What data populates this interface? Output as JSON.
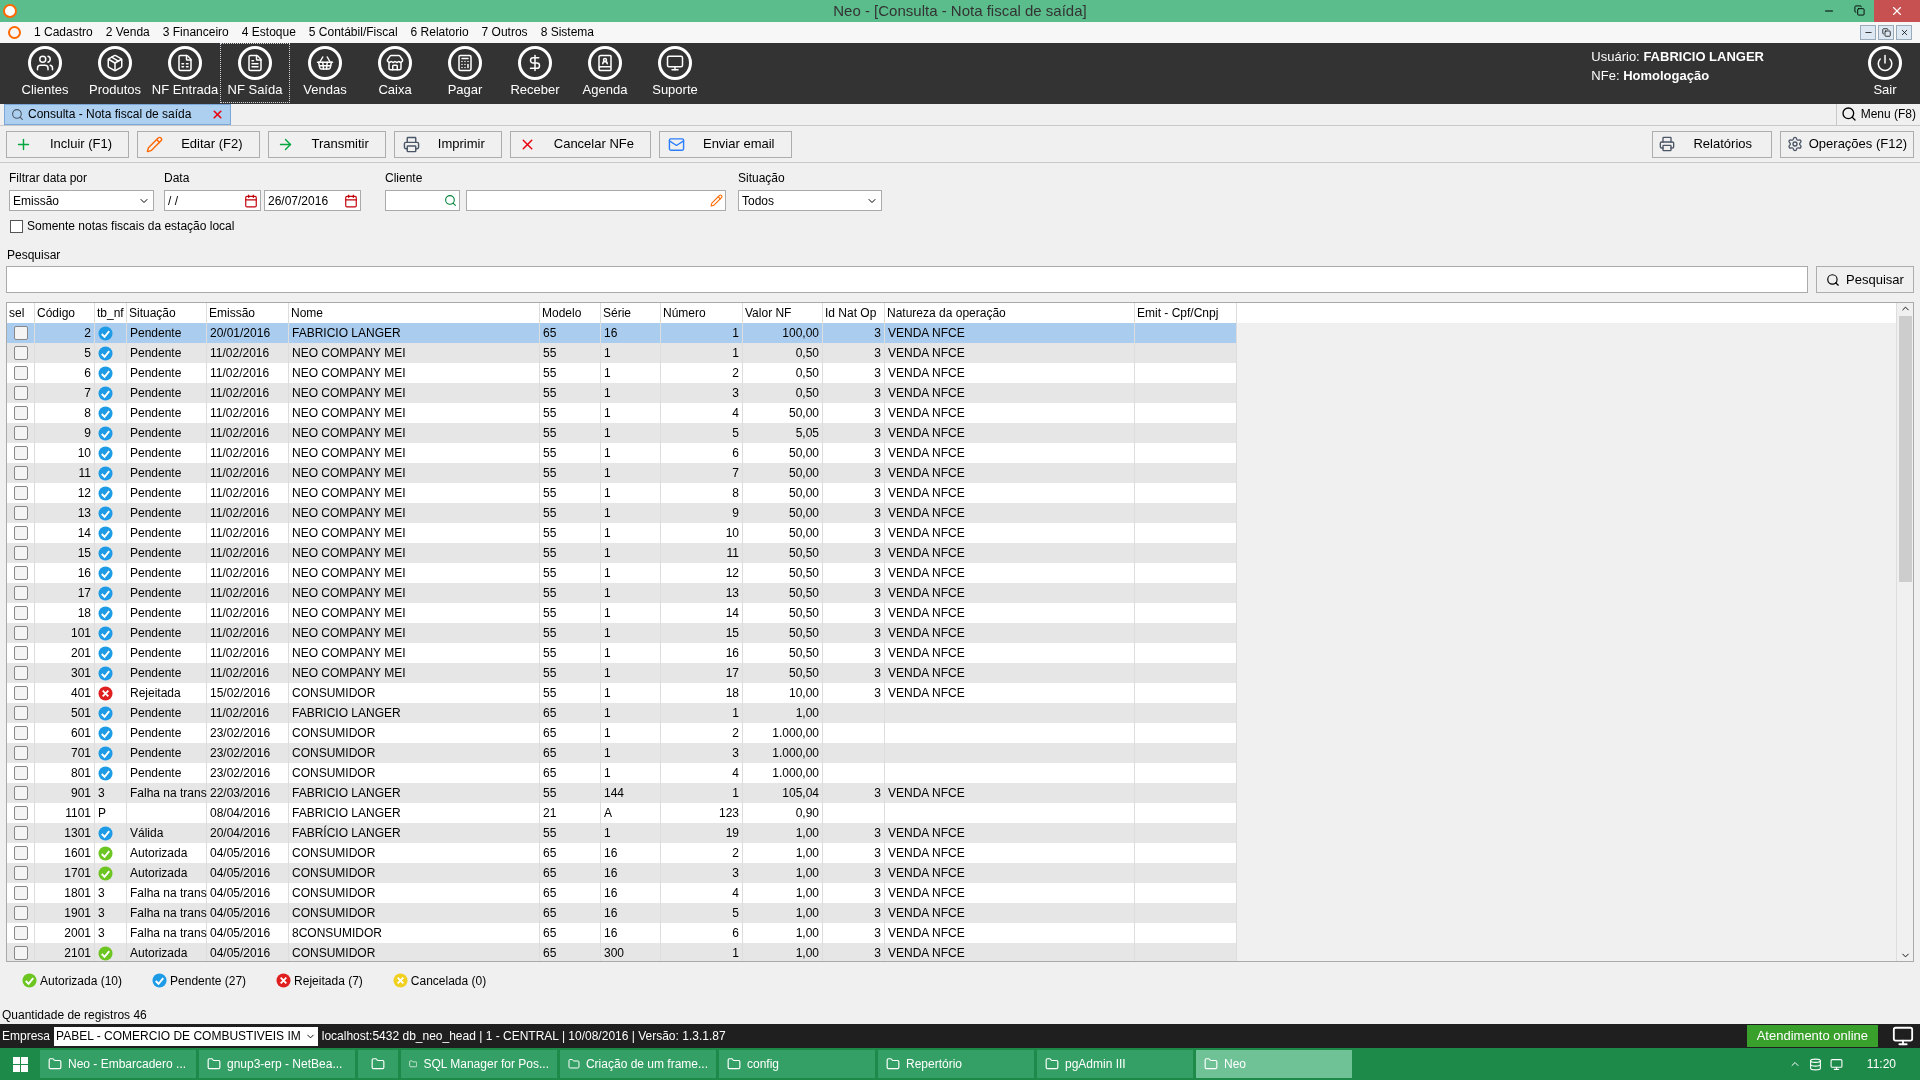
{
  "window": {
    "title": "Neo - [Consulta - Nota fiscal de saída]"
  },
  "menu": [
    "1 Cadastro",
    "2 Venda",
    "3 Financeiro",
    "4 Estoque",
    "5 Contábil/Fiscal",
    "6 Relatorio",
    "7 Outros",
    "8 Sistema"
  ],
  "toolbar": [
    {
      "label": "Clientes",
      "selected": false
    },
    {
      "label": "Produtos",
      "selected": false
    },
    {
      "label": "NF Entrada",
      "selected": false
    },
    {
      "label": "NF Saída",
      "selected": true
    },
    {
      "label": "Vendas",
      "selected": false
    },
    {
      "label": "Caixa",
      "selected": false
    },
    {
      "label": "Pagar",
      "selected": false
    },
    {
      "label": "Receber",
      "selected": false
    },
    {
      "label": "Agenda",
      "selected": false
    },
    {
      "label": "Suporte",
      "selected": false
    }
  ],
  "user": {
    "user_label": "Usuário:",
    "user": "FABRICIO LANGER",
    "nfe_label": "NFe:",
    "nfe": "Homologação"
  },
  "exit": {
    "label": "Sair"
  },
  "tabs": [
    {
      "label": "Consulta - Nota fiscal de saída",
      "selected": true
    }
  ],
  "menu_search": {
    "label": "Menu (F8)"
  },
  "actions": [
    "Incluir (F1)",
    "Editar (F2)",
    "Transmitir",
    "Imprimir",
    "Cancelar NFe",
    "Enviar email"
  ],
  "actions_right": [
    "Relatórios",
    "Operações (F12)"
  ],
  "filters": {
    "date_by_label": "Filtrar data por",
    "date_by": "Emissão",
    "date_label": "Data",
    "date_from": "/ /",
    "date_to": "26/07/2016",
    "client_label": "Cliente",
    "status_label": "Situação",
    "status": "Todos",
    "local_only": {
      "label": "Somente notas fiscais da estação local",
      "checked": false
    }
  },
  "search": {
    "label": "Pesquisar",
    "button": "Pesquisar"
  },
  "table": {
    "columns": [
      {
        "label": "sel",
        "kind": "check"
      },
      {
        "label": "Código",
        "kind": "num"
      },
      {
        "label": "tb_nf",
        "kind": "status"
      },
      {
        "label": "Situação",
        "kind": "text"
      },
      {
        "label": "Emissão",
        "kind": "text"
      },
      {
        "label": "Nome",
        "kind": "text"
      },
      {
        "label": "Modelo",
        "kind": "text"
      },
      {
        "label": "Série",
        "kind": "text"
      },
      {
        "label": "Número",
        "kind": "num"
      },
      {
        "label": "Valor NF",
        "kind": "num"
      },
      {
        "label": "Id Nat Op",
        "kind": "num"
      },
      {
        "label": "Natureza da operação",
        "kind": "text"
      },
      {
        "label": "Emit - Cpf/Cnpj",
        "kind": "text"
      }
    ],
    "rows": [
      {
        "selected": true,
        "checked": false,
        "tb_nf": {
          "kind": "pending"
        },
        "codigo": "2",
        "situacao": "Pendente",
        "emissao": "20/01/2016",
        "nome": "FABRICIO LANGER",
        "modelo": "65",
        "serie": "16",
        "numero": "1",
        "valor_nf": "100,00",
        "id_nat_op": "3",
        "natureza": "VENDA NFCE"
      },
      {
        "selected": false,
        "checked": false,
        "tb_nf": {
          "kind": "pending"
        },
        "codigo": "5",
        "situacao": "Pendente",
        "emissao": "11/02/2016",
        "nome": "NEO COMPANY MEI",
        "modelo": "55",
        "serie": "1",
        "numero": "1",
        "valor_nf": "0,50",
        "id_nat_op": "3",
        "natureza": "VENDA NFCE"
      },
      {
        "selected": false,
        "checked": false,
        "tb_nf": {
          "kind": "pending"
        },
        "codigo": "6",
        "situacao": "Pendente",
        "emissao": "11/02/2016",
        "nome": "NEO COMPANY MEI",
        "modelo": "55",
        "serie": "1",
        "numero": "2",
        "valor_nf": "0,50",
        "id_nat_op": "3",
        "natureza": "VENDA NFCE"
      },
      {
        "selected": false,
        "checked": false,
        "tb_nf": {
          "kind": "pending"
        },
        "codigo": "7",
        "situacao": "Pendente",
        "emissao": "11/02/2016",
        "nome": "NEO COMPANY MEI",
        "modelo": "55",
        "serie": "1",
        "numero": "3",
        "valor_nf": "0,50",
        "id_nat_op": "3",
        "natureza": "VENDA NFCE"
      },
      {
        "selected": false,
        "checked": false,
        "tb_nf": {
          "kind": "pending"
        },
        "codigo": "8",
        "situacao": "Pendente",
        "emissao": "11/02/2016",
        "nome": "NEO COMPANY MEI",
        "modelo": "55",
        "serie": "1",
        "numero": "4",
        "valor_nf": "50,00",
        "id_nat_op": "3",
        "natureza": "VENDA NFCE"
      },
      {
        "selected": false,
        "checked": false,
        "tb_nf": {
          "kind": "pending"
        },
        "codigo": "9",
        "situacao": "Pendente",
        "emissao": "11/02/2016",
        "nome": "NEO COMPANY MEI",
        "modelo": "55",
        "serie": "1",
        "numero": "5",
        "valor_nf": "5,05",
        "id_nat_op": "3",
        "natureza": "VENDA NFCE"
      },
      {
        "selected": false,
        "checked": false,
        "tb_nf": {
          "kind": "pending"
        },
        "codigo": "10",
        "situacao": "Pendente",
        "emissao": "11/02/2016",
        "nome": "NEO COMPANY MEI",
        "modelo": "55",
        "serie": "1",
        "numero": "6",
        "valor_nf": "50,00",
        "id_nat_op": "3",
        "natureza": "VENDA NFCE"
      },
      {
        "selected": false,
        "checked": false,
        "tb_nf": {
          "kind": "pending"
        },
        "codigo": "11",
        "situacao": "Pendente",
        "emissao": "11/02/2016",
        "nome": "NEO COMPANY MEI",
        "modelo": "55",
        "serie": "1",
        "numero": "7",
        "valor_nf": "50,00",
        "id_nat_op": "3",
        "natureza": "VENDA NFCE"
      },
      {
        "selected": false,
        "checked": false,
        "tb_nf": {
          "kind": "pending"
        },
        "codigo": "12",
        "situacao": "Pendente",
        "emissao": "11/02/2016",
        "nome": "NEO COMPANY MEI",
        "modelo": "55",
        "serie": "1",
        "numero": "8",
        "valor_nf": "50,00",
        "id_nat_op": "3",
        "natureza": "VENDA NFCE"
      },
      {
        "selected": false,
        "checked": false,
        "tb_nf": {
          "kind": "pending"
        },
        "codigo": "13",
        "situacao": "Pendente",
        "emissao": "11/02/2016",
        "nome": "NEO COMPANY MEI",
        "modelo": "55",
        "serie": "1",
        "numero": "9",
        "valor_nf": "50,00",
        "id_nat_op": "3",
        "natureza": "VENDA NFCE"
      },
      {
        "selected": false,
        "checked": false,
        "tb_nf": {
          "kind": "pending"
        },
        "codigo": "14",
        "situacao": "Pendente",
        "emissao": "11/02/2016",
        "nome": "NEO COMPANY MEI",
        "modelo": "55",
        "serie": "1",
        "numero": "10",
        "valor_nf": "50,00",
        "id_nat_op": "3",
        "natureza": "VENDA NFCE"
      },
      {
        "selected": false,
        "checked": false,
        "tb_nf": {
          "kind": "pending"
        },
        "codigo": "15",
        "situacao": "Pendente",
        "emissao": "11/02/2016",
        "nome": "NEO COMPANY MEI",
        "modelo": "55",
        "serie": "1",
        "numero": "11",
        "valor_nf": "50,50",
        "id_nat_op": "3",
        "natureza": "VENDA NFCE"
      },
      {
        "selected": false,
        "checked": false,
        "tb_nf": {
          "kind": "pending"
        },
        "codigo": "16",
        "situacao": "Pendente",
        "emissao": "11/02/2016",
        "nome": "NEO COMPANY MEI",
        "modelo": "55",
        "serie": "1",
        "numero": "12",
        "valor_nf": "50,50",
        "id_nat_op": "3",
        "natureza": "VENDA NFCE"
      },
      {
        "selected": false,
        "checked": false,
        "tb_nf": {
          "kind": "pending"
        },
        "codigo": "17",
        "situacao": "Pendente",
        "emissao": "11/02/2016",
        "nome": "NEO COMPANY MEI",
        "modelo": "55",
        "serie": "1",
        "numero": "13",
        "valor_nf": "50,50",
        "id_nat_op": "3",
        "natureza": "VENDA NFCE"
      },
      {
        "selected": false,
        "checked": false,
        "tb_nf": {
          "kind": "pending"
        },
        "codigo": "18",
        "situacao": "Pendente",
        "emissao": "11/02/2016",
        "nome": "NEO COMPANY MEI",
        "modelo": "55",
        "serie": "1",
        "numero": "14",
        "valor_nf": "50,50",
        "id_nat_op": "3",
        "natureza": "VENDA NFCE"
      },
      {
        "selected": false,
        "checked": false,
        "tb_nf": {
          "kind": "pending"
        },
        "codigo": "101",
        "situacao": "Pendente",
        "emissao": "11/02/2016",
        "nome": "NEO COMPANY MEI",
        "modelo": "55",
        "serie": "1",
        "numero": "15",
        "valor_nf": "50,50",
        "id_nat_op": "3",
        "natureza": "VENDA NFCE"
      },
      {
        "selected": false,
        "checked": false,
        "tb_nf": {
          "kind": "pending"
        },
        "codigo": "201",
        "situacao": "Pendente",
        "emissao": "11/02/2016",
        "nome": "NEO COMPANY MEI",
        "modelo": "55",
        "serie": "1",
        "numero": "16",
        "valor_nf": "50,50",
        "id_nat_op": "3",
        "natureza": "VENDA NFCE"
      },
      {
        "selected": false,
        "checked": false,
        "tb_nf": {
          "kind": "pending"
        },
        "codigo": "301",
        "situacao": "Pendente",
        "emissao": "11/02/2016",
        "nome": "NEO COMPANY MEI",
        "modelo": "55",
        "serie": "1",
        "numero": "17",
        "valor_nf": "50,50",
        "id_nat_op": "3",
        "natureza": "VENDA NFCE"
      },
      {
        "selected": false,
        "checked": false,
        "tb_nf": {
          "kind": "rejected"
        },
        "codigo": "401",
        "situacao": "Rejeitada",
        "emissao": "15/02/2016",
        "nome": "CONSUMIDOR",
        "modelo": "55",
        "serie": "1",
        "numero": "18",
        "valor_nf": "10,00",
        "id_nat_op": "3",
        "natureza": "VENDA NFCE"
      },
      {
        "selected": false,
        "checked": false,
        "tb_nf": {
          "kind": "pending"
        },
        "codigo": "501",
        "situacao": "Pendente",
        "emissao": "11/02/2016",
        "nome": "FABRICIO LANGER",
        "modelo": "65",
        "serie": "1",
        "numero": "1",
        "valor_nf": "1,00"
      },
      {
        "selected": false,
        "checked": false,
        "tb_nf": {
          "kind": "pending"
        },
        "codigo": "601",
        "situacao": "Pendente",
        "emissao": "23/02/2016",
        "nome": "CONSUMIDOR",
        "modelo": "65",
        "serie": "1",
        "numero": "2",
        "valor_nf": "1.000,00"
      },
      {
        "selected": false,
        "checked": false,
        "tb_nf": {
          "kind": "pending"
        },
        "codigo": "701",
        "situacao": "Pendente",
        "emissao": "23/02/2016",
        "nome": "CONSUMIDOR",
        "modelo": "65",
        "serie": "1",
        "numero": "3",
        "valor_nf": "1.000,00"
      },
      {
        "selected": false,
        "checked": false,
        "tb_nf": {
          "kind": "pending"
        },
        "codigo": "801",
        "situacao": "Pendente",
        "emissao": "23/02/2016",
        "nome": "CONSUMIDOR",
        "modelo": "65",
        "serie": "1",
        "numero": "4",
        "valor_nf": "1.000,00"
      },
      {
        "selected": false,
        "checked": false,
        "tb_nf": {
          "kind": "text",
          "text": "3"
        },
        "codigo": "901",
        "situacao": "Falha na trans",
        "emissao": "22/03/2016",
        "nome": "FABRICIO LANGER",
        "modelo": "55",
        "serie": "144",
        "numero": "1",
        "valor_nf": "105,04",
        "id_nat_op": "3",
        "natureza": "VENDA NFCE"
      },
      {
        "selected": false,
        "checked": false,
        "tb_nf": {
          "kind": "text",
          "text": "P"
        },
        "codigo": "1101",
        "emissao": "08/04/2016",
        "nome": "FABRICIO LANGER",
        "modelo": "21",
        "serie": "A",
        "numero": "123",
        "valor_nf": "0,90"
      },
      {
        "selected": false,
        "checked": false,
        "tb_nf": {
          "kind": "pending"
        },
        "codigo": "1301",
        "situacao": "Válida",
        "emissao": "20/04/2016",
        "nome": "FABRÍCIO LANGER",
        "modelo": "55",
        "serie": "1",
        "numero": "19",
        "valor_nf": "1,00",
        "id_nat_op": "3",
        "natureza": "VENDA NFCE"
      },
      {
        "selected": false,
        "checked": false,
        "tb_nf": {
          "kind": "authorized"
        },
        "codigo": "1601",
        "situacao": "Autorizada",
        "emissao": "04/05/2016",
        "nome": "CONSUMIDOR",
        "modelo": "65",
        "serie": "16",
        "numero": "2",
        "valor_nf": "1,00",
        "id_nat_op": "3",
        "natureza": "VENDA NFCE"
      },
      {
        "selected": false,
        "checked": false,
        "tb_nf": {
          "kind": "authorized"
        },
        "codigo": "1701",
        "situacao": "Autorizada",
        "emissao": "04/05/2016",
        "nome": "CONSUMIDOR",
        "modelo": "65",
        "serie": "16",
        "numero": "3",
        "valor_nf": "1,00",
        "id_nat_op": "3",
        "natureza": "VENDA NFCE"
      },
      {
        "selected": false,
        "checked": false,
        "tb_nf": {
          "kind": "text",
          "text": "3"
        },
        "codigo": "1801",
        "situacao": "Falha na trans",
        "emissao": "04/05/2016",
        "nome": "CONSUMIDOR",
        "modelo": "65",
        "serie": "16",
        "numero": "4",
        "valor_nf": "1,00",
        "id_nat_op": "3",
        "natureza": "VENDA NFCE"
      },
      {
        "selected": false,
        "checked": false,
        "tb_nf": {
          "kind": "text",
          "text": "3"
        },
        "codigo": "1901",
        "situacao": "Falha na trans",
        "emissao": "04/05/2016",
        "nome": "CONSUMIDOR",
        "modelo": "65",
        "serie": "16",
        "numero": "5",
        "valor_nf": "1,00",
        "id_nat_op": "3",
        "natureza": "VENDA NFCE"
      },
      {
        "selected": false,
        "checked": false,
        "tb_nf": {
          "kind": "text",
          "text": "3"
        },
        "codigo": "2001",
        "situacao": "Falha na trans",
        "emissao": "04/05/2016",
        "nome": "8CONSUMIDOR",
        "modelo": "65",
        "serie": "16",
        "numero": "6",
        "valor_nf": "1,00",
        "id_nat_op": "3",
        "natureza": "VENDA NFCE"
      },
      {
        "selected": false,
        "checked": false,
        "tb_nf": {
          "kind": "authorized"
        },
        "codigo": "2101",
        "situacao": "Autorizada",
        "emissao": "04/05/2016",
        "nome": "CONSUMIDOR",
        "modelo": "65",
        "serie": "300",
        "numero": "1",
        "valor_nf": "1,00",
        "id_nat_op": "3",
        "natureza": "VENDA NFCE"
      }
    ]
  },
  "legend": [
    {
      "kind": "authorized",
      "label": "Autorizada (10)"
    },
    {
      "kind": "pending",
      "label": "Pendente (27)"
    },
    {
      "kind": "rejected",
      "label": "Rejeitada (7)"
    },
    {
      "kind": "cancelled",
      "label": "Cancelada (0)"
    }
  ],
  "record_count": "Quantidade de registros 46",
  "status_bar": {
    "company_label": "Empresa",
    "company": "PABEL - COMERCIO DE COMBUSTIVEIS IM",
    "info": "localhost:5432 db_neo_head | 1 - CENTRAL | 10/08/2016 | Versão: 1.3.1.87",
    "support": "Atendimento online"
  },
  "taskbar": {
    "items": [
      {
        "label": "Neo - Embarcadero ...",
        "selected": false
      },
      {
        "label": "gnup3-erp - NetBea...",
        "selected": false
      },
      {
        "selected": false
      },
      {
        "label": "SQL Manager for Pos...",
        "selected": false
      },
      {
        "label": "Criação de um frame...",
        "selected": false
      },
      {
        "label": "config",
        "selected": false
      },
      {
        "label": "Repertório",
        "selected": false
      },
      {
        "label": "pgAdmin III",
        "selected": false
      },
      {
        "label": "Neo",
        "selected": true
      }
    ],
    "time": "11:20"
  }
}
